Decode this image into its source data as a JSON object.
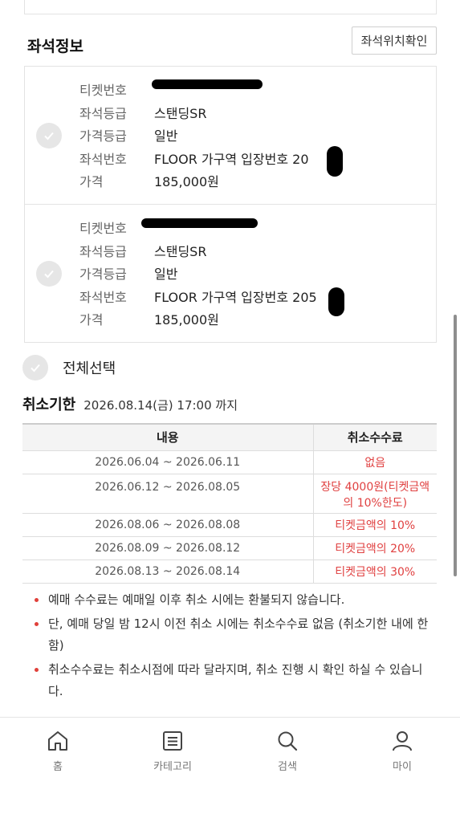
{
  "seat_info": {
    "title": "좌석정보",
    "locate_button": "좌석위치확인"
  },
  "tickets": [
    {
      "ticket_no_label": "티켓번호",
      "grade_label": "좌석등급",
      "grade": "스탠딩SR",
      "price_grade_label": "가격등급",
      "price_grade": "일반",
      "seat_no_label": "좌석번호",
      "seat_no": "FLOOR 가구역 입장번호 20",
      "price_label": "가격",
      "price": "185,000원"
    },
    {
      "ticket_no_label": "티켓번호",
      "grade_label": "좌석등급",
      "grade": "스탠딩SR",
      "price_grade_label": "가격등급",
      "price_grade": "일반",
      "seat_no_label": "좌석번호",
      "seat_no": "FLOOR 가구역 입장번호 205",
      "price_label": "가격",
      "price": "185,000원"
    }
  ],
  "select_all_label": "전체선택",
  "cancel_deadline": {
    "title": "취소기한",
    "date": "2026.08.14(금) 17:00 까지"
  },
  "fee_table": {
    "headers": [
      "내용",
      "취소수수료"
    ],
    "rows": [
      {
        "period": "2026.06.04 ~ 2026.06.11",
        "fee": "없음"
      },
      {
        "period": "2026.06.12 ~ 2026.08.05",
        "fee_line1": "장당 4000원(티켓금액",
        "fee_line2": "의 10%한도)"
      },
      {
        "period": "2026.08.06 ~ 2026.08.08",
        "fee": "티켓금액의 10%"
      },
      {
        "period": "2026.08.09 ~ 2026.08.12",
        "fee": "티켓금액의 20%"
      },
      {
        "period": "2026.08.13 ~ 2026.08.14",
        "fee": "티켓금액의 30%"
      }
    ]
  },
  "notes": [
    "예매 수수료는 예매일 이후 취소 시에는 환불되지 않습니다.",
    "단, 예매 당일 밤 12시 이전 취소 시에는 취소수수료 없음 (취소기한 내에 한함)",
    "취소수수료는 취소시점에 따라 달라지며, 취소 진행 시 확인 하실 수 있습니다."
  ],
  "bottom_nav": [
    {
      "label": "홈",
      "icon": "home-icon"
    },
    {
      "label": "카테고리",
      "icon": "category-icon"
    },
    {
      "label": "검색",
      "icon": "search-icon"
    },
    {
      "label": "마이",
      "icon": "user-icon"
    }
  ],
  "colors": {
    "accent_red": "#e04040",
    "check_gray": "#e6e6e6"
  }
}
